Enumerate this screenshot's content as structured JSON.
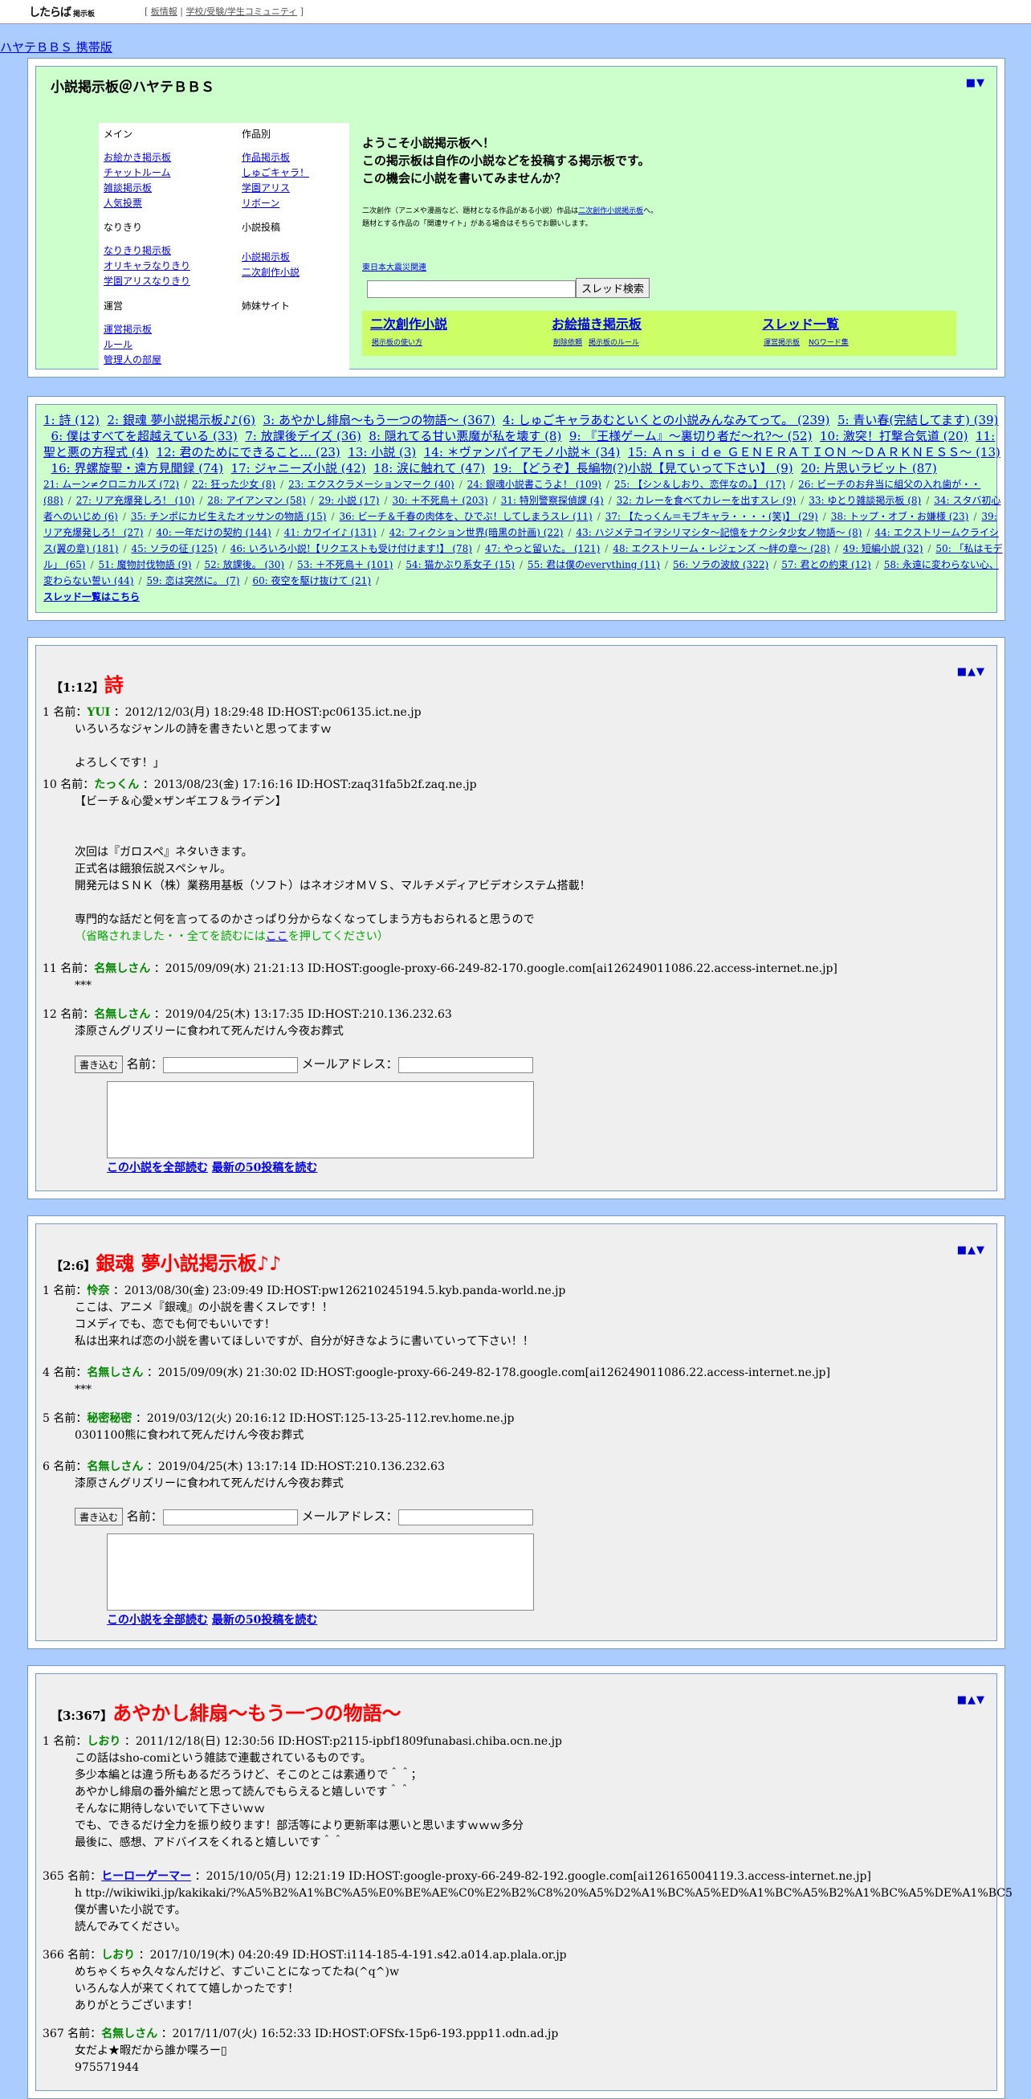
{
  "topbar": {
    "logo": "したらば",
    "logo_sub": "掲示板",
    "links_open": "[ ",
    "link1": "板情報",
    "link_sep": " | ",
    "link2": "学校/受験/学生コミュニティ",
    "links_close": " ]"
  },
  "board_link": "ハヤテＢＢＳ 携帯版",
  "header": {
    "title": "小説掲示板＠ハヤテＢＢＳ",
    "nav": "■▼",
    "menu": {
      "main_heading": "メイン",
      "main_items": [
        "お絵かき掲示板",
        "チャットルーム",
        "雑談掲示板",
        "人気投票"
      ],
      "works_heading": "作品別",
      "works_items": [
        "作品掲示板",
        "しゅごキャラ！",
        "学園アリス",
        "リボーン"
      ],
      "nari_heading": "なりきり",
      "nari_items": [
        "なりきり掲示板",
        "オリキャラなりきり",
        "学園アリスなりきり"
      ],
      "novel_heading": "小説投稿",
      "novel_items": [
        "小説掲示板",
        "二次創作小説"
      ],
      "admin_heading": "運営",
      "admin_items": [
        "運営掲示板",
        "ルール",
        "管理人の部屋"
      ],
      "sister_heading": "姉妹サイト"
    },
    "welcome": [
      "ようこそ小説掲示板へ！",
      "この掲示板は自作の小説などを投稿する掲示板です。",
      "この機会に小説を書いてみませんか？"
    ],
    "note_line1_pre": "二次創作（アニメや漫画など、題材となる作品がある小説）作品は",
    "note_link": "二次創作小説掲示板",
    "note_line1_post": "へ。",
    "note_line2": "題材とする作品の「関連サイト」がある場合はそちらでお願いします。",
    "quake_link": "東日本大震災関連",
    "search_button": "スレッド検索",
    "lime": {
      "big1": "二次創作小説",
      "big2": "お絵描き掲示板",
      "big3": "スレッド一覧",
      "sub1": "掲示板の使い方",
      "sub2a": "削除依頼",
      "sub2b": "掲示板のルール",
      "sub3a": "運営掲示板",
      "sub3b": "NGワード集"
    }
  },
  "thread_list_big": [
    {
      "n": "1",
      "t": "詩 (12)"
    },
    {
      "n": "2",
      "t": "銀魂 夢小説掲示板♪♪(6)"
    },
    {
      "n": "3",
      "t": "あやかし緋扇～もう一つの物語～ (367)"
    },
    {
      "n": "4",
      "t": "しゅごキャラあむといくとの小説みんなみてって。 (239)"
    },
    {
      "n": "5",
      "t": "青い春(完結してます) (39)"
    },
    {
      "n": "6",
      "t": "僕はすべてを超越えている (33)"
    },
    {
      "n": "7",
      "t": "放課後デイズ (36)"
    },
    {
      "n": "8",
      "t": "隠れてる甘い悪魔が私を壊す (8)"
    },
    {
      "n": "9",
      "t": "『王様ゲーム』～裏切り者だ～れ?～ (52)"
    },
    {
      "n": "10",
      "t": "激突！打撃合気道 (20)"
    },
    {
      "n": "11",
      "t": "聖と悪の方程式 (4)"
    },
    {
      "n": "12",
      "t": "君のためにできること… (23)"
    },
    {
      "n": "13",
      "t": "小説 (3)"
    },
    {
      "n": "14",
      "t": "＊ヴァンパイアモノ小説＊ (34)"
    },
    {
      "n": "15",
      "t": "Ａｎｓｉｄｅ ＧＥＮＥＲＡＴＩＯＮ ～ＤＡＲＫＮＥＳＳ～ (13)"
    },
    {
      "n": "16",
      "t": "界螺旋聖・遠方見聞録 (74)"
    },
    {
      "n": "17",
      "t": "ジャニーズ小説 (42)"
    },
    {
      "n": "18",
      "t": "涙に触れて (47)"
    },
    {
      "n": "19",
      "t": "【どうぞ】長編物(?)小説【見ていって下さい】 (9)"
    },
    {
      "n": "20",
      "t": "片思いラビット (87)"
    }
  ],
  "thread_list_small": [
    "21: ムーン≠クロニカルズ (72)",
    "22: 狂った少女 (8)",
    "23: エクスクラメーションマーク (40)",
    "24: 銀魂小説書こうよ！ (109)",
    "25: 【シン＆しおり、恋伴なの。】 (17)",
    "26: ビーチのお弁当に組父の入れ歯が・・(88)",
    "27: リア充爆発しろ！ (10)",
    "28: アイアンマン (58)",
    "29: 小説 (17)",
    "30: ＋不死鳥＋ (203)",
    "31: 特別警察探偵課 (4)",
    "32: カレーを食べてカレーを出すスレ (9)",
    "33: ゆとり雑談掲示板 (8)",
    "34: スタバ初心者へのいじめ (6)",
    "35: チンポにカビ生えたオッサンの物語 (15)",
    "36: ビーチ＆千春の肉体を、ひでぶ！してしまうスレ (11)",
    "37: 【たっくん＝モブキャラ・・・・(笑)】 (29)",
    "38: トップ・オブ・お嫌様 (23)",
    "39: リア充爆発しろ！ (27)",
    "40: 一年だけの契約 (144)",
    "41: カワイイ♪ (131)",
    "42: フィクション世界(暗黒の計画) (22)",
    "43: ハジメテコイヲシリマシタ～記憶をナクシタ少女ノ物語～ (8)",
    "44: エクストリームクライシス(翼の章) (181)",
    "45: ソラの征 (125)",
    "46: いろいろ小説!【リクエストも受け付けます!】 (78)",
    "47: やっと留いた。 (121)",
    "48: エクストリーム・レジェンズ ～絆の章～ (28)",
    "49: 短編小説 (32)",
    "50: 「私はモデル」 (65)",
    "51: 魔物討伐物語 (9)",
    "52: 放課後。 (30)",
    "53: ＋不死鳥＋ (101)",
    "54: 猫かぶり系女子 (15)",
    "55: 君は僕のeverything (11)",
    "56: ソラの波紋 (322)",
    "57: 君との約束 (12)",
    "58: 永遠に変わらない心、変わらない誓い (44)",
    "59: 恋は突然に。 (7)",
    "60: 夜空を駆け抜けて (21)"
  ],
  "thread_list_all": "スレッド一覧はこちら",
  "threads": [
    {
      "no": "【1:12】",
      "title": "詩",
      "nav": "■▲▼",
      "posts": [
        {
          "num": "1",
          "label": " 名前：",
          "name": "YUI",
          "meta": " ：2012/12/03(月) 18:29:48 ID:HOST:pc06135.ict.ne.jp",
          "body": "いろいろなジャンルの詩を書きたいと思ってますｗ\n\nよろしくです！」"
        },
        {
          "num": "10",
          "label": " 名前：",
          "name": "たっくん",
          "meta": " ：2013/08/23(金) 17:16:16 ID:HOST:zaq31fa5b2f.zaq.ne.jp",
          "body": "【ビーチ＆心愛×ザンギエフ＆ライデン】\n\n\n次回は『ガロスペ』ネタいきます。\n正式名は餓狼伝説スペシャル。\n開発元はＳＮＫ（株）業務用基板（ソフト）はネオジオＭＶＳ、マルチメディアビデオシステム搭載！\n\n専門的な話だと何を言ってるのかさっぱり分からなくなってしまう方もおられると思うので"
        },
        {
          "num": "11",
          "label": " 名前：",
          "name": "名無しさん",
          "meta": " ：2015/09/09(水) 21:21:13 ID:HOST:google-proxy-66-249-82-170.google.com[ai126249011086.22.access-internet.ne.jp]",
          "body": "***"
        },
        {
          "num": "12",
          "label": " 名前：",
          "name": "名無しさん",
          "meta": " ：2019/04/25(木) 13:17:35 ID:HOST:210.136.232.63",
          "body": "漆原さんグリズリーに食われて死んだけん今夜お葬式"
        }
      ],
      "omit_pre": "（省略されました・・全てを読むには",
      "omit_link": "ここ",
      "omit_post": "を押してください）"
    },
    {
      "no": "【2:6】",
      "title": "銀魂 夢小説掲示板♪♪",
      "nav": "■▲▼",
      "posts": [
        {
          "num": "1",
          "label": " 名前：",
          "name": "怜奈",
          "meta": " ：2013/08/30(金) 23:09:49 ID:HOST:pw126210245194.5.kyb.panda-world.ne.jp",
          "body": "ここは、アニメ『銀魂』の小説を書くスレです！！\nコメディでも、恋でも何でもいいです！\n私は出来れば恋の小説を書いてほしいですが、自分が好きなように書いていって下さい！！"
        },
        {
          "num": "4",
          "label": " 名前：",
          "name": "名無しさん",
          "meta": " ：2015/09/09(水) 21:30:02 ID:HOST:google-proxy-66-249-82-178.google.com[ai126249011086.22.access-internet.ne.jp]",
          "body": "***"
        },
        {
          "num": "5",
          "label": " 名前：",
          "name": "秘密秘密",
          "meta": " ：2019/03/12(火) 20:16:12 ID:HOST:125-13-25-112.rev.home.ne.jp",
          "body": "0301100熊に食われて死んだけん今夜お葬式"
        },
        {
          "num": "6",
          "label": " 名前：",
          "name": "名無しさん",
          "meta": " ：2019/04/25(木) 13:17:14 ID:HOST:210.136.232.63",
          "body": "漆原さんグリズリーに食われて死んだけん今夜お葬式"
        }
      ]
    },
    {
      "no": "【3:367】",
      "title": "あやかし緋扇～もう一つの物語～",
      "nav": "■▲▼",
      "posts": [
        {
          "num": "1",
          "label": " 名前：",
          "name": "しおり",
          "meta": " ：2011/12/18(日) 12:30:56 ID:HOST:p2115-ipbf1809funabasi.chiba.ocn.ne.jp",
          "body": "この話はsho-comiという雑誌で連載されているものです。\n多少本編とは違う所もあるだろうけど、そこのとこは素通りで＾＾；\nあやかし緋扇の番外編だと思って読んでもらえると嬉しいです＾＾\nそんなに期待しないでいて下さいｗｗ\nでも、できるだけ全力を振り絞ります！部活等により更新率は悪いと思いますｗｗｗ多分\n最後に、感想、アドバイスをくれると嬉しいです＾＾"
        },
        {
          "num": "365",
          "label": " 名前：",
          "name": "ヒーローゲーマー",
          "meta": " ：2015/10/05(月) 12:21:19 ID:HOST:google-proxy-66-249-82-192.google.com[ai126165004119.3.access-internet.ne.jp]",
          "body": "h ttp://wikiwiki.jp/kakikaki/?%A5%B2%A1%BC%A5%E0%BE%AE%C0%E2%B2%C8%20%A5%D2%A1%BC%A5%ED%A1%BC%A5%B2%A1%BC%A5%DE%A1%BC5\n僕が書いた小説です。\n読んでみてください。"
        },
        {
          "num": "366",
          "label": " 名前：",
          "name": "しおり",
          "meta": " ：2017/10/19(木) 04:20:49 ID:HOST:i114-185-4-191.s42.a014.ap.plala.or.jp",
          "body": "めちゃくちゃ久々なんだけど、すごいことになってたね(^q^)w\nいろんな人が来てくれてて嬉しかったです！\nありがとうございます！"
        },
        {
          "num": "367",
          "label": " 名前：",
          "name": "名無しさん",
          "meta": " ：2017/11/07(火) 16:52:33 ID:HOST:OFSfx-15p6-193.ppp11.odn.ad.jp",
          "body": "女だよ★暇だから誰か喋ろー▯\n975571944"
        }
      ]
    }
  ],
  "form": {
    "submit": "書き込む",
    "name_label": " 名前：",
    "mail_label": " メールアドレス：",
    "read_all": "この小説を全部読む",
    "read_50": "最新の50投稿を読む"
  }
}
